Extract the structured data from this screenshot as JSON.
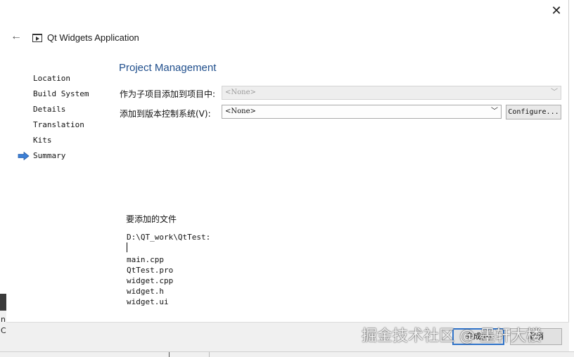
{
  "window": {
    "title": "Qt Widgets Application",
    "close_glyph": "✕",
    "back_glyph": "←"
  },
  "nav": {
    "items": [
      "Location",
      "Build System",
      "Details",
      "Translation",
      "Kits",
      "Summary"
    ],
    "current_index": 5
  },
  "page": {
    "title": "Project Management",
    "subproject_label": "作为子项目添加到项目中:",
    "subproject_value": "<None>",
    "vcs_label": "添加到版本控制系统(V):",
    "vcs_value": "<None>",
    "configure_label": "Configure..."
  },
  "files": {
    "heading": "要添加的文件",
    "path": "D:\\QT_work\\QtTest:",
    "items": [
      "main.cpp",
      "QtTest.pro",
      "widget.cpp",
      "widget.h",
      "widget.ui"
    ]
  },
  "buttons": {
    "finish": "完成(F)",
    "cancel": "取消"
  },
  "watermark": "掘金技术社区 @ 墨轩大楼",
  "background": {
    "glyphs": [
      "n",
      "C"
    ]
  },
  "colors": {
    "accent": "#2e72c9",
    "title_blue": "#1f4e8c",
    "arrow_blue": "#3c7fd6"
  }
}
